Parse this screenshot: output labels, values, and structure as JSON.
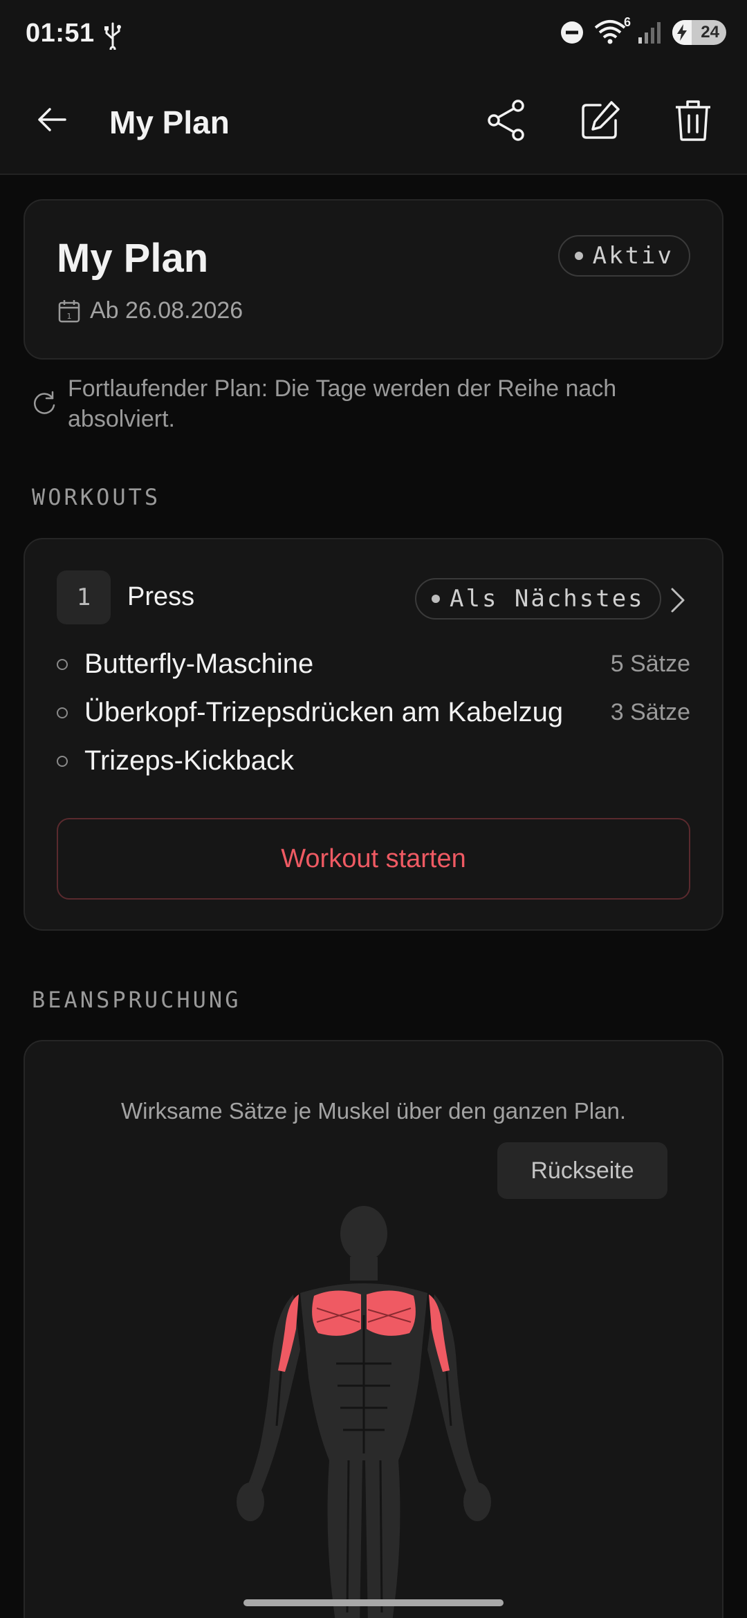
{
  "status_bar": {
    "time": "01:51",
    "network_badge": "6",
    "battery": "24"
  },
  "app_bar": {
    "title": "My Plan",
    "icons": [
      "back-arrow-icon",
      "share-icon",
      "edit-icon",
      "delete-icon"
    ]
  },
  "plan": {
    "title": "My Plan",
    "status": "Aktiv",
    "date": "Ab 26.08.2026",
    "info": "Fortlaufender Plan: Die Tage werden der Reihe nach absolviert."
  },
  "workouts": {
    "section_label": "WORKOUTS",
    "items": [
      {
        "number": "1",
        "name": "Press",
        "badge": "Als Nächstes",
        "exercises": [
          {
            "name": "Butterfly-Maschine",
            "sets": "5 Sätze"
          },
          {
            "name": "Überkopf-Trizepsdrücken am Kabelzug",
            "sets": "3 Sätze"
          },
          {
            "name": "Trizeps-Kickback",
            "sets": ""
          }
        ],
        "start_label": "Workout starten"
      }
    ]
  },
  "strain": {
    "section_label": "BEANSPRUCHUNG",
    "description": "Wirksame Sätze je Muskel über den ganzen Plan.",
    "toggle_label": "Rückseite",
    "highlight_color": "#ef5a63"
  }
}
